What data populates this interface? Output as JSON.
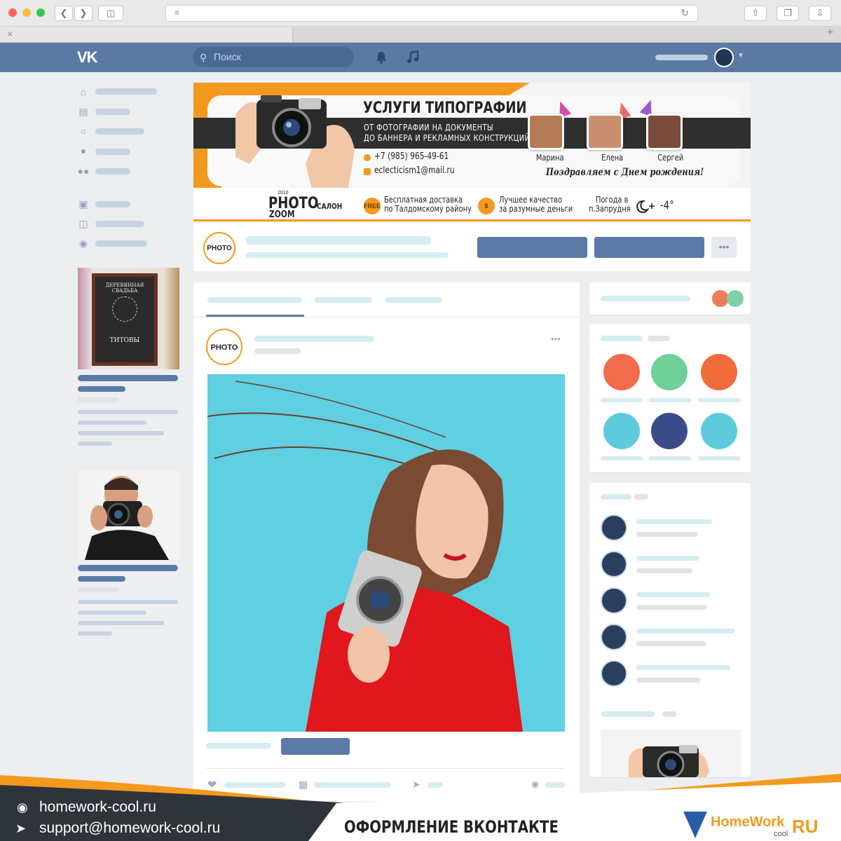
{
  "browser": {
    "url": ""
  },
  "header": {
    "logo": "VK",
    "search_placeholder": "Поиск"
  },
  "cover": {
    "title": "УСЛУГИ ТИПОГРАФИИ",
    "subtitle_1": "ОТ ФОТОГРАФИИ НА ДОКУМЕНТЫ",
    "subtitle_2": "ДО БАННЕРА И РЕКЛАМНЫХ КОНСТРУКЦИЙ",
    "phone": "+7 (985) 965-49-61",
    "email": "eclecticism1@mail.ru",
    "birthdays": [
      "Марина",
      "Елена",
      "Сергей"
    ],
    "greeting": "Поздравляем с Днем рождения!",
    "brand_year": "2010",
    "brand_main": "PHOTO",
    "brand_suffix": "САЛОН",
    "brand_sub": "ZOOM",
    "feature_1_line1": "Бесплатная доставка",
    "feature_1_line2": "по Талдомскому району",
    "feature_2_line1": "Лучшее качество",
    "feature_2_line2": "за разумные деньги",
    "weather_line1": "Погода в",
    "weather_line2": "п.Запрудня",
    "weather_temp": "-4°",
    "badge_free": "FREE",
    "badge_money": "$"
  },
  "sidebar": {
    "promo_1_title": "ДЕРЕВЯННАЯ СВАДЬБА",
    "promo_1_names": "ТИТОВЫ"
  },
  "promo": {
    "site": "homework-cool.ru",
    "support": "support@homework-cool.ru",
    "caption": "ОФОРМЛЕНИЕ ВКОНТАКТЕ",
    "brand_home": "HomeWork",
    "brand_cool": "cool",
    "brand_ru": "RU"
  },
  "colors": {
    "vk_blue": "#5a7aa4",
    "accent_orange": "#f39a1e",
    "placeholder_blue": "#d5ecf2",
    "photo_bg": "#5ed0e2"
  },
  "icons": [
    "home-icon",
    "news-icon",
    "messages-icon",
    "friends-icon",
    "groups-icon",
    "market-icon",
    "documents-icon",
    "games-icon",
    "bell-icon",
    "music-icon",
    "heart-icon",
    "comment-icon",
    "share-icon",
    "eye-icon",
    "globe-icon",
    "send-icon"
  ]
}
